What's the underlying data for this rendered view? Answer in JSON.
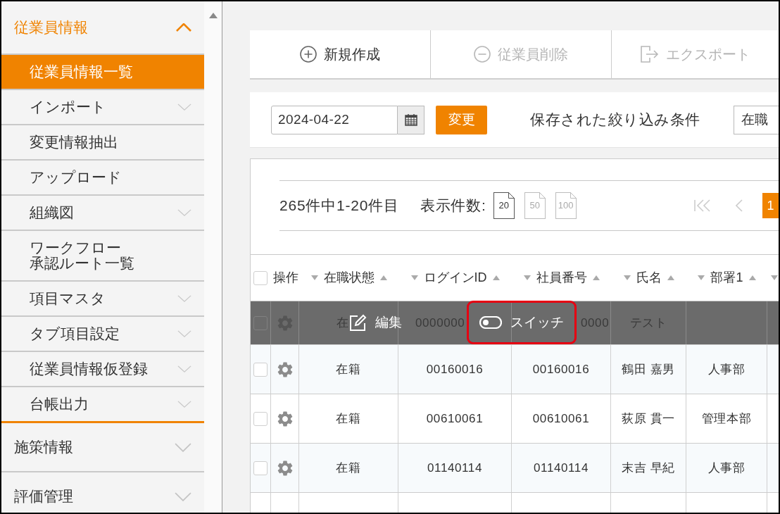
{
  "sidebar": {
    "groups": [
      {
        "label": "従業員情報",
        "expanded": true,
        "children": [
          {
            "label": "従業員情報一覧",
            "selected": true,
            "has_submenu": false
          },
          {
            "label": "インポート",
            "selected": false,
            "has_submenu": true
          },
          {
            "label": "変更情報抽出",
            "selected": false,
            "has_submenu": false
          },
          {
            "label": "アップロード",
            "selected": false,
            "has_submenu": false
          },
          {
            "label": "組織図",
            "selected": false,
            "has_submenu": true
          },
          {
            "label_lines": [
              "ワークフロー",
              "承認ルート一覧"
            ],
            "selected": false,
            "has_submenu": false
          },
          {
            "label": "項目マスタ",
            "selected": false,
            "has_submenu": true
          },
          {
            "label": "タブ項目設定",
            "selected": false,
            "has_submenu": true
          },
          {
            "label": "従業員情報仮登録",
            "selected": false,
            "has_submenu": true
          },
          {
            "label": "台帳出力",
            "selected": false,
            "has_submenu": true
          }
        ]
      },
      {
        "label": "施策情報",
        "expanded": false
      },
      {
        "label": "評価管理",
        "expanded": false
      }
    ]
  },
  "toolbar": {
    "buttons": [
      {
        "kind": "add",
        "label": "新規作成",
        "disabled": false
      },
      {
        "kind": "delete",
        "label": "従業員削除",
        "disabled": true
      },
      {
        "kind": "export",
        "label": "エクスポート",
        "disabled": true
      }
    ]
  },
  "filter": {
    "date": {
      "value": "2024-04-22"
    },
    "apply_button": "変更",
    "saved_filter_label": "保存された絞り込み条件",
    "saved_filter": {
      "value": "在職"
    }
  },
  "pagination": {
    "summary": "265件中1-20件目",
    "page_size_label": "表示件数:",
    "page_sizes": [
      {
        "label": "20",
        "selected": true
      },
      {
        "label": "50",
        "selected": false
      },
      {
        "label": "100",
        "selected": false
      }
    ],
    "nav": [
      {
        "kind": "first",
        "disabled": true
      },
      {
        "kind": "prev",
        "disabled": true
      }
    ],
    "pages": [
      {
        "label": "1",
        "selected": true
      }
    ]
  },
  "table": {
    "select_all": {
      "checked": false
    },
    "columns": [
      {
        "label": "操作",
        "sortable": false
      },
      {
        "label": "在職状態",
        "sortable": true
      },
      {
        "label": "ログインID",
        "sortable": true
      },
      {
        "label": "社員番号",
        "sortable": true
      },
      {
        "label": "氏名",
        "sortable": true
      },
      {
        "label": "部署1",
        "sortable": true
      },
      {
        "sortable": true
      }
    ],
    "rows": [
      {
        "hovered": true,
        "checked": false,
        "cells": [
          "",
          "在",
          "0000000",
          "0000",
          "テスト"
        ]
      },
      {
        "hovered": false,
        "checked": false,
        "cells": [
          "",
          "在籍",
          "00160016",
          "00160016",
          "鶴田 嘉男",
          "人事部"
        ]
      },
      {
        "hovered": false,
        "checked": false,
        "cells": [
          "",
          "在籍",
          "00610061",
          "00610061",
          "荻原 貫一",
          "管理本部"
        ]
      },
      {
        "hovered": false,
        "checked": false,
        "cells": [
          "",
          "在籍",
          "01140114",
          "01140114",
          "末吉 早紀",
          "人事部"
        ]
      }
    ],
    "row_actions": [
      {
        "kind": "edit",
        "label": "編集",
        "highlighted": false
      },
      {
        "kind": "toggle",
        "label": "スイッチ",
        "highlighted": true
      }
    ]
  }
}
